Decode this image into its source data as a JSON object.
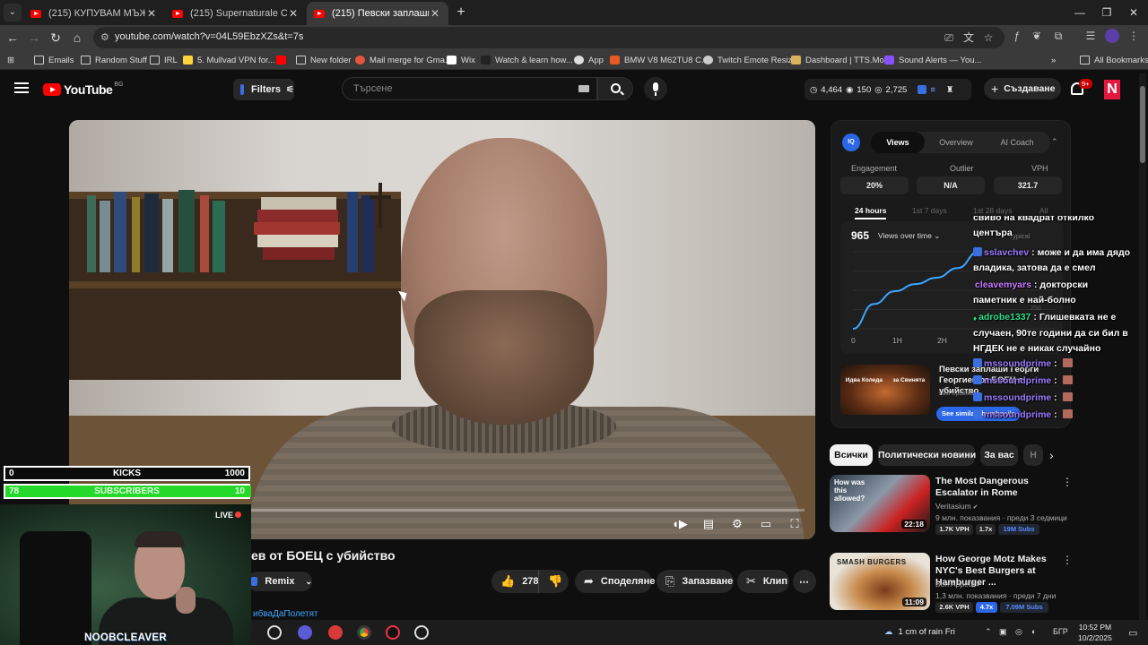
{
  "browser": {
    "tabs": [
      {
        "title": "(215) КУПУВАМ МЪЖКА КОЛА",
        "active": false
      },
      {
        "title": "(215) Supernaturale Compilatio",
        "active": false
      },
      {
        "title": "(215) Певски заплаши Георги",
        "active": true
      }
    ],
    "new_tab": "+",
    "url": "youtube.com/watch?v=04L59EbzXZs&t=7s",
    "bookmarks": [
      {
        "label": "Emails",
        "icon": "folder-icon"
      },
      {
        "label": "Random Stuff",
        "icon": "folder-icon"
      },
      {
        "label": "IRL",
        "icon": "folder-icon"
      },
      {
        "label": "5. Mullvad VPN for...",
        "icon": "mullvad-icon"
      },
      {
        "label": "",
        "icon": "youtube-icon"
      },
      {
        "label": "New folder",
        "icon": "folder-icon"
      },
      {
        "label": "Mail merge for Gma...",
        "icon": "mailmerge-icon"
      },
      {
        "label": "Wix",
        "icon": "wix-icon"
      },
      {
        "label": "Watch & learn how...",
        "icon": "watch-icon"
      },
      {
        "label": "App",
        "icon": "app-icon"
      },
      {
        "label": "BMW V8 M62TU8 C...",
        "icon": "bmw-icon"
      },
      {
        "label": "Twitch Emote Resizer",
        "icon": "globe-icon"
      },
      {
        "label": "Dashboard | TTS.Mo...",
        "icon": "dashboard-icon"
      },
      {
        "label": "Sound Alerts — You...",
        "icon": "soundalerts-icon"
      }
    ],
    "all_bookmarks": "All Bookmarks"
  },
  "youtube": {
    "logo": "YouTube",
    "country": "BG",
    "filters": "Filters",
    "search_placeholder": "Търсене",
    "stats": {
      "views": "4,464",
      "likes": "150",
      "subs": "2,725"
    },
    "create": "Създаване",
    "notifications": "9+",
    "avatar_letter": "N"
  },
  "video": {
    "title": "ев от БОЕЦ с убийство",
    "channel": "ибваДаПолетят",
    "remix": "Remix",
    "likes": "278",
    "share": "Споделяне",
    "save": "Запазване",
    "clip": "Клип"
  },
  "overlay": {
    "kicks": {
      "current": "0",
      "label": "KICKS",
      "goal": "1000"
    },
    "subs": {
      "current": "78",
      "label": "SUBSCRIBERS",
      "goal": "10"
    },
    "live": "LIVE",
    "streamer": "NOOBCLEAVER"
  },
  "vidiq": {
    "logo": "IQ",
    "tabs": [
      "Views",
      "Overview",
      "AI Coach"
    ],
    "active_tab": "Views",
    "metrics": [
      {
        "label": "Engagement",
        "value": "20%"
      },
      {
        "label": "Outlier",
        "value": "N/A"
      },
      {
        "label": "VPH",
        "value": "321.7"
      }
    ],
    "ranges": [
      "24 hours",
      "1st 7 days",
      "1st 28 days",
      "All"
    ],
    "total_views": "965",
    "views_over_time": "Views over time",
    "typical": "Typical",
    "this_video": "This video",
    "y_tick": "250",
    "suggestion": {
      "thumb_text_left": "Идва Коледа",
      "thumb_text_right": "за Свинята",
      "title": "Певски заплаши Георги Георгиев от БОЕЦ с убийство",
      "last_updated": "Last Updated",
      "button": "See similar thumbnails"
    }
  },
  "chart_data": {
    "type": "line",
    "title": "Views over time",
    "x_ticks": [
      "0",
      "1H",
      "2H"
    ],
    "y_label": "",
    "series": [
      {
        "name": "This video",
        "color": "#3ea6ff",
        "values": [
          0,
          310,
          470,
          560,
          640,
          760,
          965
        ]
      },
      {
        "name": "Typical",
        "color": "#5b5b5b",
        "values": []
      }
    ],
    "total": 965
  },
  "chat": [
    {
      "user": "",
      "message": "свиво на квадрат откилко центъра",
      "color": "#ffffff",
      "badge": "none"
    },
    {
      "user": "sslavchev",
      "message": "може и да има дядо владика, затова да е смел",
      "color": "#9b7bff",
      "badge": "prime"
    },
    {
      "user": "cleavemyars",
      "message": "докторски паметник е най-болно",
      "color": "#c77bff",
      "badge": "none"
    },
    {
      "user": "adrobe1337",
      "message": "Глишевката не е случаен, 90те години да си бил в НГДЕК не е никак случайно",
      "color": "#2ee08c",
      "badge": "leaf"
    },
    {
      "user": "mssoundprime",
      "message": "",
      "color": "#9b7bff",
      "badge": "prime"
    },
    {
      "user": "mssoundprime",
      "message": "",
      "color": "#9b7bff",
      "badge": "prime"
    },
    {
      "user": "mssoundprime",
      "message": "",
      "color": "#9b7bff",
      "badge": "prime"
    },
    {
      "user": "mssoundprime",
      "message": "",
      "color": "#9b7bff",
      "badge": "prime"
    }
  ],
  "chips": [
    "Всички",
    "Политически новини",
    "За вас",
    "Н"
  ],
  "recommended": [
    {
      "title": "The Most Dangerous Escalator in Rome",
      "channel": "Veritasium",
      "meta": "9 млн. показвания · преди 3 седмици",
      "duration": "22:18",
      "thumb_text": "How was this allowed?",
      "vph": "1.7K VPH",
      "mult": "1.7x",
      "subs": "19M Subs"
    },
    {
      "title": "How George Motz Makes NYC's Best Burgers at Hamburger ...",
      "channel": "Bon Appétit",
      "meta": "1,3 млн. показвания · преди 7 дни",
      "duration": "11:09",
      "thumb_text": "SMASH BURGERS",
      "vph": "2.6K VPH",
      "mult": "4.7x",
      "subs": "7.09M Subs"
    }
  ],
  "taskbar": {
    "weather": "1 cm of rain Fri",
    "lang": "БГР",
    "time": "10:52 PM",
    "date": "10/2/2025"
  },
  "colors": {
    "bg": "#0f0f0f",
    "yt_red": "#ff0000",
    "vidiq_blue": "#2b67e6",
    "goal_green": "#25d92b"
  }
}
